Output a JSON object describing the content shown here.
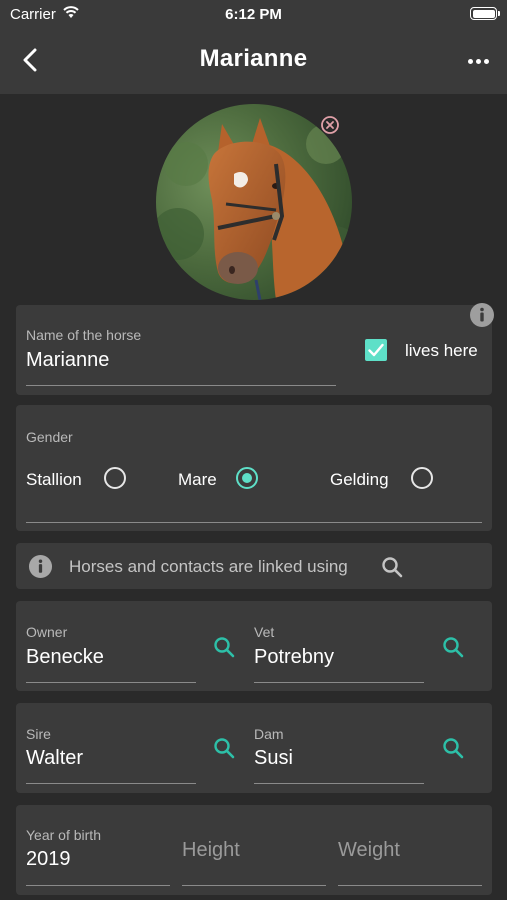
{
  "status_bar": {
    "carrier": "Carrier",
    "time": "6:12 PM"
  },
  "nav": {
    "title": "Marianne",
    "back_icon": "chevron-left-icon",
    "more_icon": "more-horizontal-icon"
  },
  "photo": {
    "remove_icon": "close-circle-icon"
  },
  "name_card": {
    "label": "Name of the horse",
    "value": "Marianne",
    "lives_here_label": "lives here",
    "lives_here_checked": true,
    "info_icon": "info-icon"
  },
  "gender": {
    "label": "Gender",
    "options": [
      {
        "label": "Stallion",
        "selected": false
      },
      {
        "label": "Mare",
        "selected": true
      },
      {
        "label": "Gelding",
        "selected": false
      }
    ]
  },
  "link_hint": {
    "text": "Horses and contacts are linked using",
    "icon": "search-icon"
  },
  "contacts": {
    "owner": {
      "label": "Owner",
      "value": "Benecke"
    },
    "vet": {
      "label": "Vet",
      "value": "Potrebny"
    }
  },
  "pedigree": {
    "sire": {
      "label": "Sire",
      "value": "Walter"
    },
    "dam": {
      "label": "Dam",
      "value": "Susi"
    }
  },
  "physical": {
    "year_label": "Year of birth",
    "year_value": "2019",
    "height_placeholder": "Height",
    "weight_placeholder": "Weight"
  },
  "colors": {
    "accent": "#5ee0c8",
    "background": "#2a2a2a",
    "card": "#3b3b3b",
    "bar": "#3a3a3a"
  }
}
